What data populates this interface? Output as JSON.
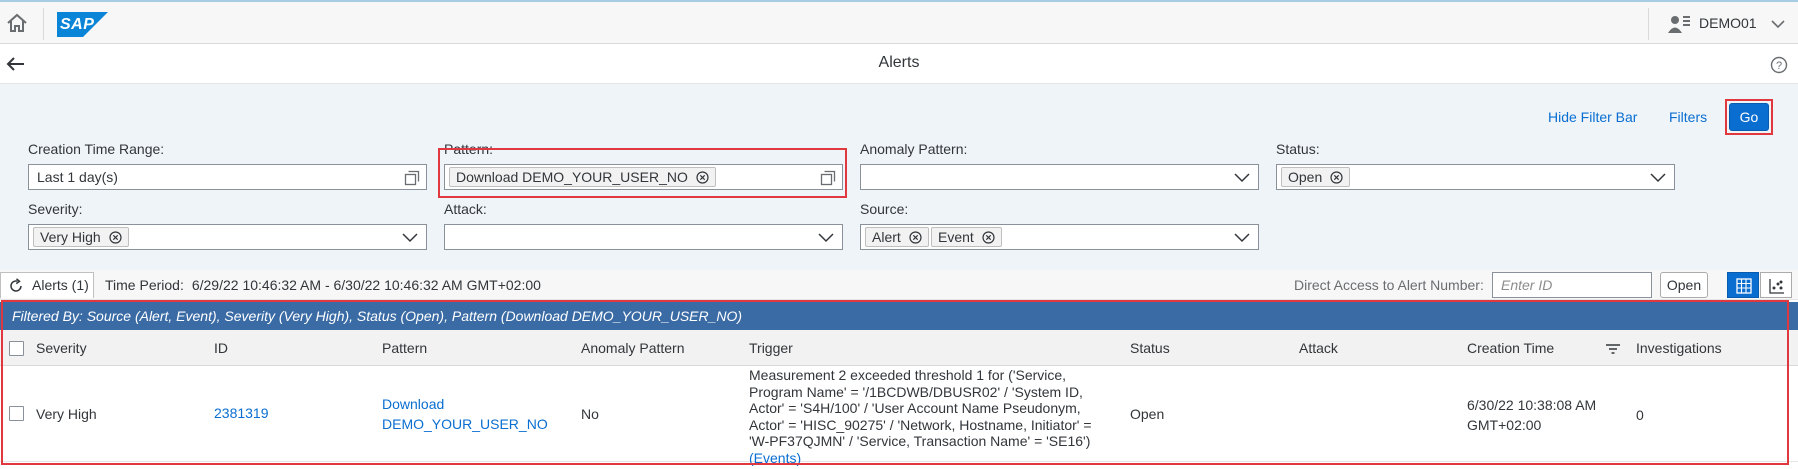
{
  "shell": {
    "brand": "SAP",
    "user": "DEMO01"
  },
  "header": {
    "title": "Alerts"
  },
  "filterbar": {
    "hide_label": "Hide Filter Bar",
    "filters_label": "Filters",
    "go_label": "Go",
    "fields": {
      "creation_time": {
        "label": "Creation Time Range:",
        "value": "Last 1 day(s)"
      },
      "pattern": {
        "label": "Pattern:",
        "tokens": [
          "Download DEMO_YOUR_USER_NO"
        ]
      },
      "anomaly": {
        "label": "Anomaly Pattern:",
        "value": ""
      },
      "status": {
        "label": "Status:",
        "tokens": [
          "Open"
        ]
      },
      "severity": {
        "label": "Severity:",
        "tokens": [
          "Very High"
        ]
      },
      "attack": {
        "label": "Attack:",
        "value": ""
      },
      "source": {
        "label": "Source:",
        "tokens": [
          "Alert",
          "Event"
        ]
      }
    }
  },
  "toolbar": {
    "alerts_label": "Alerts (1)",
    "time_period_label": "Time Period:",
    "time_period_value": "6/29/22 10:46:32 AM - 6/30/22 10:46:32 AM GMT+02:00",
    "direct_access_label": "Direct Access to Alert Number:",
    "enter_id_placeholder": "Enter ID",
    "open_label": "Open"
  },
  "infobar": {
    "text": "Filtered By: Source (Alert, Event), Severity (Very High), Status (Open), Pattern (Download DEMO_YOUR_USER_NO)"
  },
  "table": {
    "columns": [
      "Severity",
      "ID",
      "Pattern",
      "Anomaly Pattern",
      "Trigger",
      "Status",
      "Attack",
      "Creation Time",
      "Investigations"
    ],
    "rows": [
      {
        "severity": "Very High",
        "id": "2381319",
        "pattern_line1": "Download",
        "pattern_line2": "DEMO_YOUR_USER_NO",
        "anomaly": "No",
        "trigger": "Measurement 2 exceeded threshold 1 for ('Service, Program Name' = '/1BCDWB/DBUSR02' / 'System ID, Actor' = 'S4H/100' / 'User Account Name Pseudonym, Actor' = 'HISC_90275' / 'Network, Hostname, Initiator' = 'W-PF37QJMN' / 'Service, Transaction Name' = 'SE16')",
        "trigger_link": "(Events)",
        "status": "Open",
        "attack": "",
        "creation_time_line1": "6/30/22 10:38:08 AM",
        "creation_time_line2": "GMT+02:00",
        "investigations": "0"
      }
    ]
  },
  "colors": {
    "accent": "#0a6ed1",
    "info_bar": "#3a6ba5",
    "highlight": "#e0383e",
    "filter_bg": "#eff4f9"
  },
  "icons": [
    "home-icon",
    "user-icon",
    "chevron-down-icon",
    "back-arrow-icon",
    "help-icon",
    "value-help-icon",
    "token-remove-icon",
    "refresh-icon",
    "table-view-icon",
    "chart-view-icon",
    "sort-icon"
  ]
}
